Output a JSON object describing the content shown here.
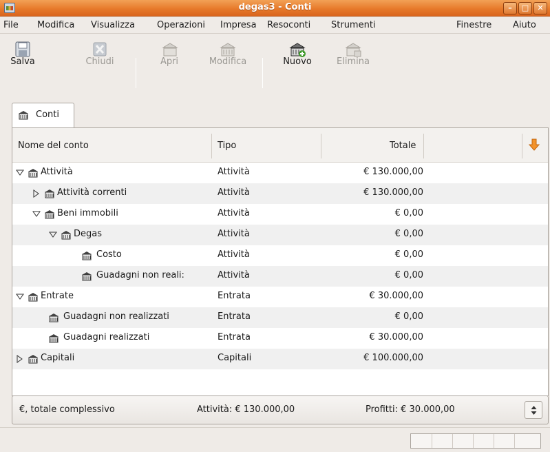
{
  "window": {
    "title": "degas3 - Conti"
  },
  "menu": [
    "File",
    "Modifica",
    "Visualizza",
    "Operazioni",
    "Impresa",
    "Resoconti",
    "Strumenti",
    "Finestre",
    "Aiuto"
  ],
  "toolbar": {
    "save": "Salva",
    "close": "Chiudi",
    "open": "Apri",
    "edit": "Modifica",
    "new": "Nuovo",
    "delete": "Elimina"
  },
  "tab": {
    "label": "Conti"
  },
  "columns": {
    "name": "Nome del conto",
    "type": "Tipo",
    "total": "Totale"
  },
  "accounts": [
    {
      "name": "Attività",
      "type": "Attività",
      "total": "€ 130.000,00"
    },
    {
      "name": "Attività correnti",
      "type": "Attività",
      "total": "€ 130.000,00"
    },
    {
      "name": "Beni immobili",
      "type": "Attività",
      "total": "€ 0,00"
    },
    {
      "name": "Degas",
      "type": "Attività",
      "total": "€ 0,00"
    },
    {
      "name": "Costo",
      "type": "Attività",
      "total": "€ 0,00"
    },
    {
      "name": "Guadagni non reali:",
      "type": "Attività",
      "total": "€ 0,00"
    },
    {
      "name": "Entrate",
      "type": "Entrata",
      "total": "€ 30.000,00"
    },
    {
      "name": "Guadagni non realizzati",
      "type": "Entrata",
      "total": "€ 0,00"
    },
    {
      "name": "Guadagni realizzati",
      "type": "Entrata",
      "total": "€ 30.000,00"
    },
    {
      "name": "Capitali",
      "type": "Capitali",
      "total": "€ 100.000,00"
    }
  ],
  "summary": {
    "label": "€, totale complessivo",
    "assets": "Attività: € 130.000,00",
    "profits": "Profitti: € 30.000,00"
  }
}
